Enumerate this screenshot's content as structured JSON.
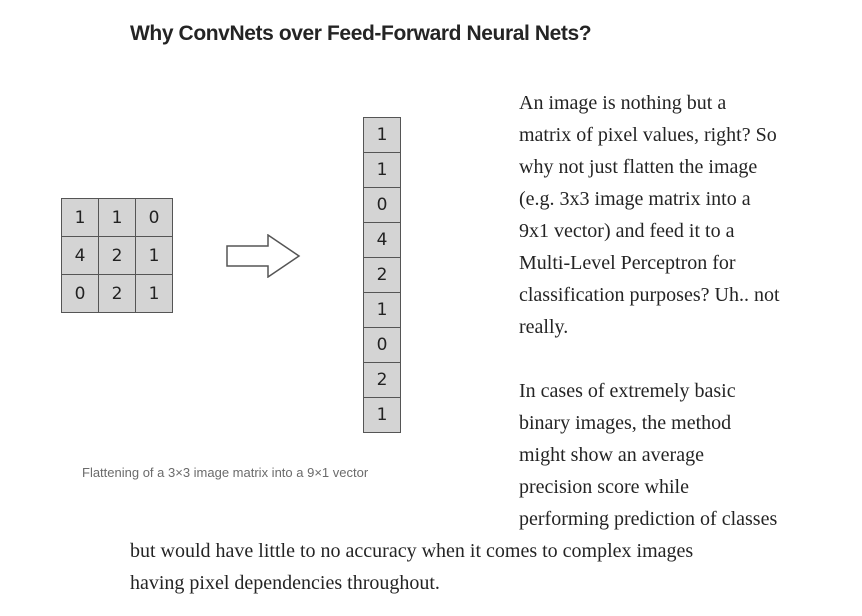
{
  "heading": "Why ConvNets over Feed-Forward Neural Nets?",
  "figure": {
    "matrix": [
      [
        "1",
        "1",
        "0"
      ],
      [
        "4",
        "2",
        "1"
      ],
      [
        "0",
        "2",
        "1"
      ]
    ],
    "vector": [
      "1",
      "1",
      "0",
      "4",
      "2",
      "1",
      "0",
      "2",
      "1"
    ],
    "caption": "Flattening of a 3×3 image matrix into a 9×1 vector",
    "arrow_icon": "right-arrow-icon"
  },
  "paragraph1_lines": [
    "An image is nothing but a",
    "matrix of pixel values, right? So",
    "why not just flatten the image",
    "(e.g. 3x3 image matrix into a",
    "9x1 vector) and feed it to a",
    "Multi-Level Perceptron for",
    "classification purposes? Uh.. not",
    "really."
  ],
  "paragraph2_lines": [
    "In cases of extremely basic",
    "binary images, the method",
    "might show an average",
    "precision score while",
    "performing prediction of classes"
  ],
  "paragraph3_lines": [
    "but would have little to no accuracy when it comes to complex images",
    "having pixel dependencies throughout."
  ]
}
